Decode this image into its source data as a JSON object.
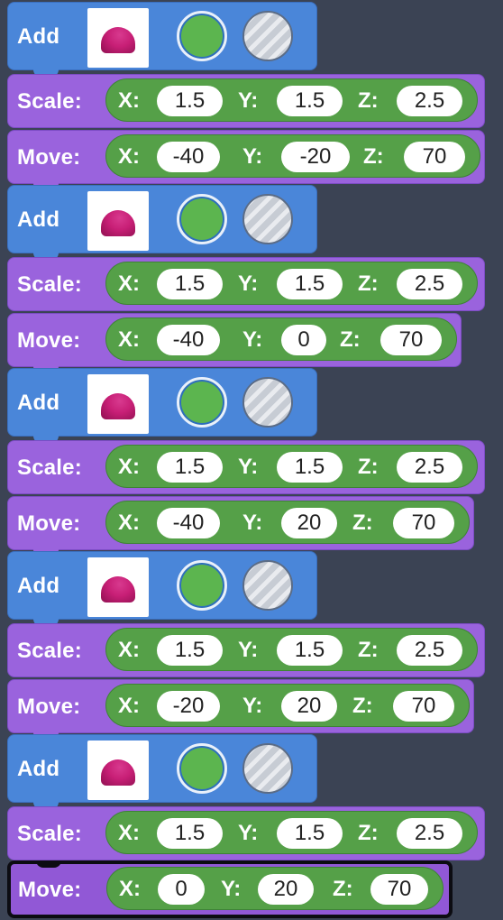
{
  "blocks": [
    {
      "label": "Add",
      "color_on": "#5cb54f"
    },
    {
      "label": "Scale:",
      "axes": [
        "X:",
        "Y:",
        "Z:"
      ],
      "values": [
        "1.5",
        "1.5",
        "2.5"
      ]
    },
    {
      "label": "Move:",
      "axes": [
        "X:",
        "Y:",
        "Z:"
      ],
      "values": [
        "-40",
        "-20",
        "70"
      ]
    },
    {
      "label": "Add",
      "color_on": "#5cb54f"
    },
    {
      "label": "Scale:",
      "axes": [
        "X:",
        "Y:",
        "Z:"
      ],
      "values": [
        "1.5",
        "1.5",
        "2.5"
      ]
    },
    {
      "label": "Move:",
      "axes": [
        "X:",
        "Y:",
        "Z:"
      ],
      "values": [
        "-40",
        "0",
        "70"
      ]
    },
    {
      "label": "Add",
      "color_on": "#5cb54f"
    },
    {
      "label": "Scale:",
      "axes": [
        "X:",
        "Y:",
        "Z:"
      ],
      "values": [
        "1.5",
        "1.5",
        "2.5"
      ]
    },
    {
      "label": "Move:",
      "axes": [
        "X:",
        "Y:",
        "Z:"
      ],
      "values": [
        "-40",
        "20",
        "70"
      ]
    },
    {
      "label": "Add",
      "color_on": "#5cb54f"
    },
    {
      "label": "Scale:",
      "axes": [
        "X:",
        "Y:",
        "Z:"
      ],
      "values": [
        "1.5",
        "1.5",
        "2.5"
      ]
    },
    {
      "label": "Move:",
      "axes": [
        "X:",
        "Y:",
        "Z:"
      ],
      "values": [
        "-20",
        "20",
        "70"
      ]
    },
    {
      "label": "Add",
      "color_on": "#5cb54f"
    },
    {
      "label": "Scale:",
      "axes": [
        "X:",
        "Y:",
        "Z:"
      ],
      "values": [
        "1.5",
        "1.5",
        "2.5"
      ]
    },
    {
      "label": "Move:",
      "axes": [
        "X:",
        "Y:",
        "Z:"
      ],
      "values": [
        "0",
        "20",
        "70"
      ]
    }
  ],
  "colors": {
    "add_block": "#4a86d9",
    "transform_block": "#9a63dd",
    "value_pill": "#55a048",
    "workspace": "#3b4354"
  },
  "icons": {
    "shape": "dome-shape-icon",
    "color_none": "no-color-icon"
  }
}
